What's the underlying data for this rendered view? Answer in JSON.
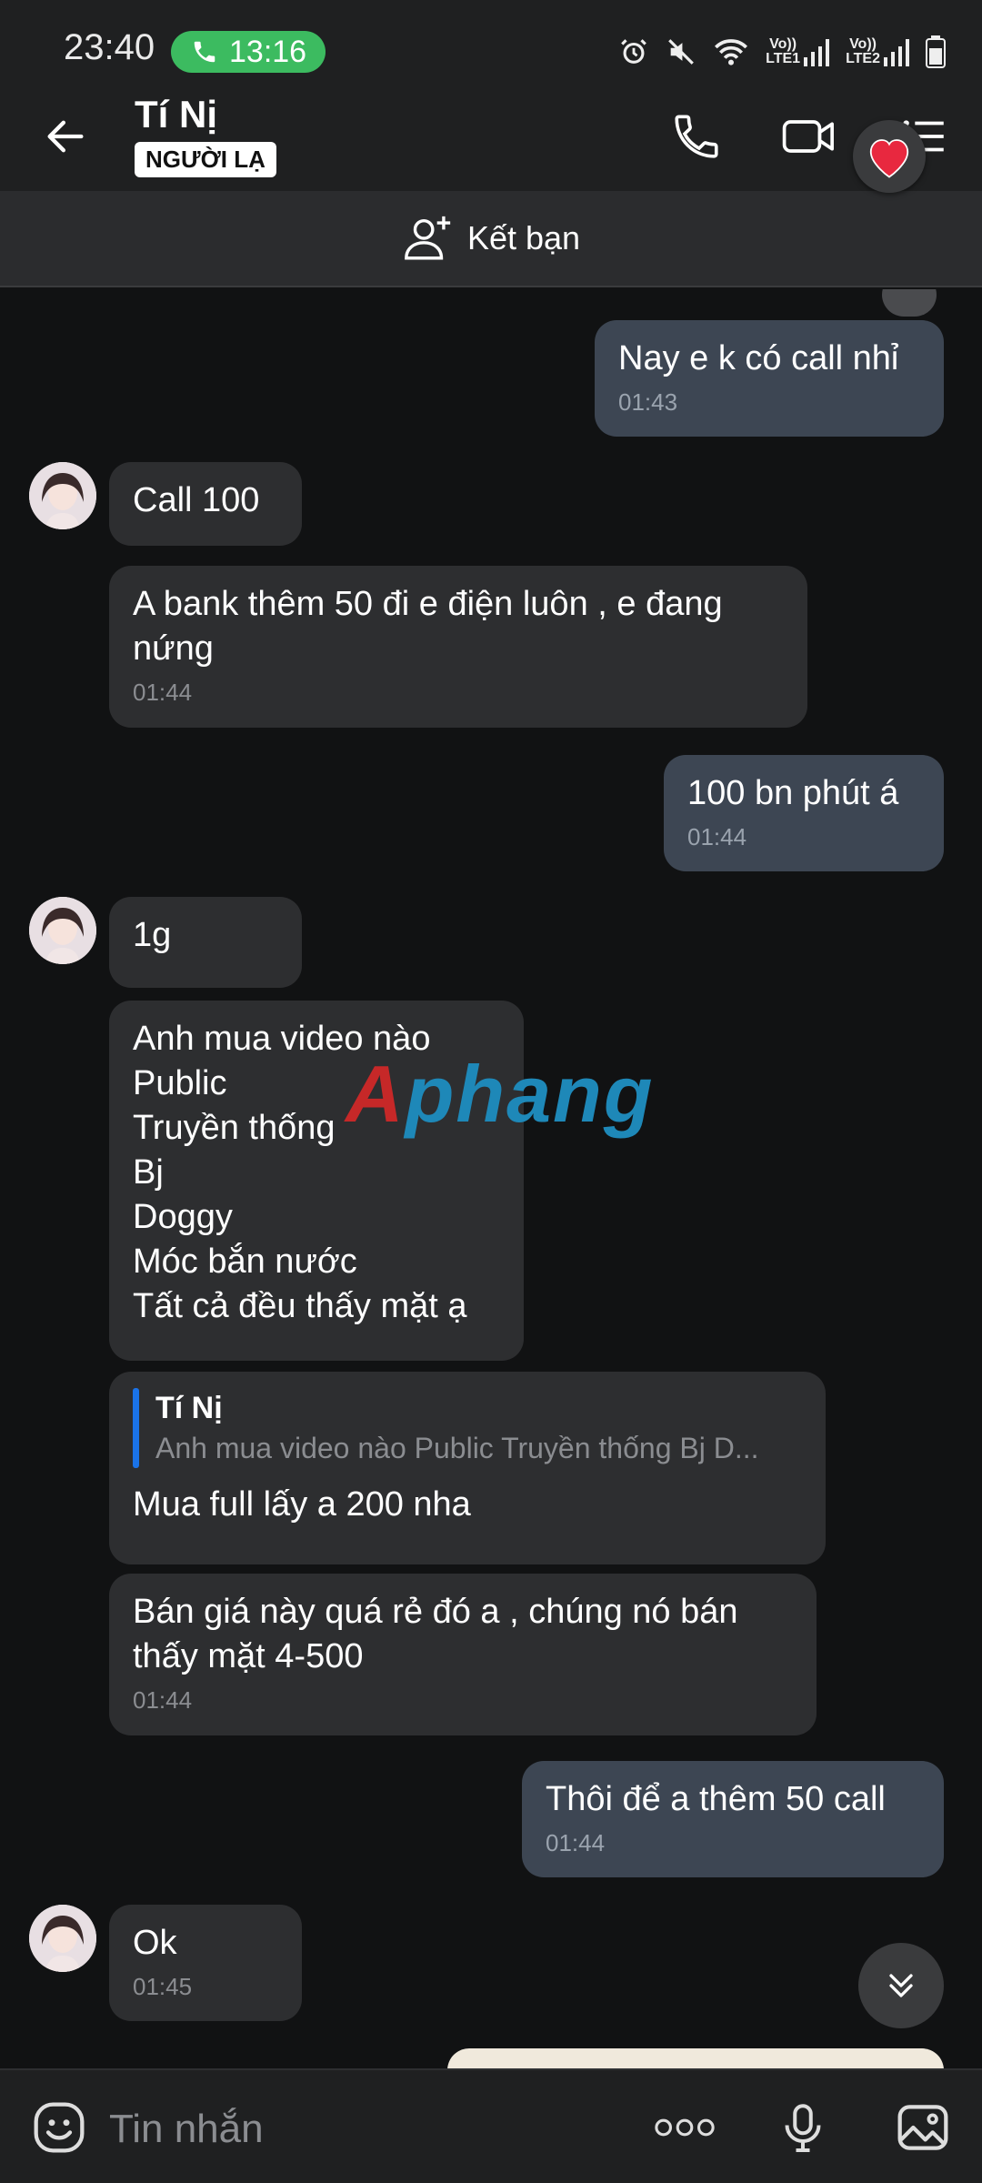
{
  "status": {
    "time": "23:40",
    "call_duration": "13:16",
    "sim1": "LTE1",
    "sim2": "LTE2",
    "volte1": "Vo))",
    "volte2": "Vo))"
  },
  "header": {
    "title": "Tí Nị",
    "badge": "NGƯỜI LẠ"
  },
  "friend_bar": {
    "label": "Kết bạn"
  },
  "messages": [
    {
      "dir": "out",
      "text": "Nay e k có call nhỉ",
      "time": "01:43"
    },
    {
      "dir": "in",
      "text": "Call 100"
    },
    {
      "dir": "in",
      "text": "A bank thêm 50 đi e điện luôn , e đang nứng",
      "time": "01:44"
    },
    {
      "dir": "out",
      "text": "100 bn phút á",
      "time": "01:44"
    },
    {
      "dir": "in",
      "text": "1g"
    },
    {
      "dir": "in",
      "lines": [
        "Anh mua video nào",
        "Public",
        "Truyền thống",
        "Bj",
        "Doggy",
        "Móc bắn nước",
        "Tất cả đều thấy mặt ạ"
      ]
    },
    {
      "dir": "in",
      "quote_name": "Tí Nị",
      "quote_text": "Anh mua video nào  Public  Truyền thống Bj D...",
      "text": "Mua full lấy a 200 nha"
    },
    {
      "dir": "in",
      "text": "Bán giá này quá rẻ đó a , chúng nó bán thấy mặt 4-500",
      "time": "01:44"
    },
    {
      "dir": "out",
      "text": "Thôi để a thêm 50 call",
      "time": "01:44"
    },
    {
      "dir": "in",
      "text": "Ok",
      "time": "01:45"
    }
  ],
  "watermark": {
    "text_a": "A",
    "text_rest": "phang",
    "color_a": "#c62828",
    "color_rest": "#1e88b8"
  },
  "composer": {
    "placeholder": "Tin nhắn"
  },
  "colors": {
    "background": "#111213",
    "incoming_bubble": "#2d2e30",
    "outgoing_bubble": "#3d4653",
    "call_pill": "#3cbb60",
    "accent": "#1a73e8"
  },
  "icons": [
    "back-arrow-icon",
    "phone-icon",
    "video-call-icon",
    "menu-icon",
    "heart-icon",
    "add-friend-icon",
    "emoji-icon",
    "more-icon",
    "mic-icon",
    "image-icon",
    "chevron-double-down-icon"
  ]
}
